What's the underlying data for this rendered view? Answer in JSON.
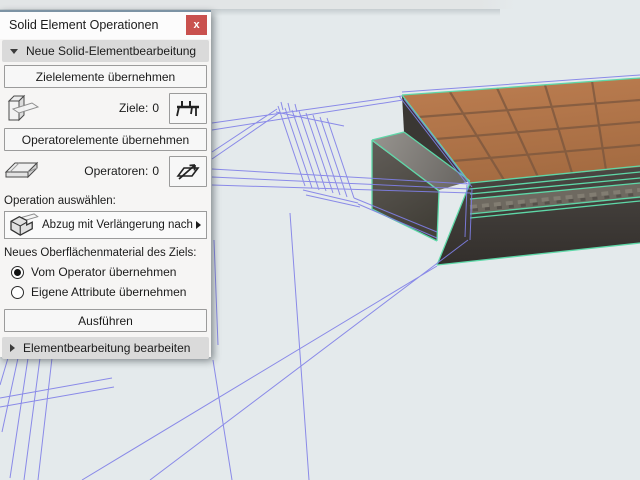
{
  "panel": {
    "title": "Solid Element Operationen",
    "close_label": "x",
    "section_new": {
      "title": "Neue Solid-Elementbearbeitung",
      "pick_targets_button": "Zielelemente übernehmen",
      "targets": {
        "label": "Ziele:",
        "value": "0"
      },
      "pick_operators_button": "Operatorelemente übernehmen",
      "operators": {
        "label": "Operatoren:",
        "value": "0"
      },
      "choose_operation_label": "Operation auswählen:",
      "operation_value": "Abzug mit Verlängerung nach ...",
      "surface_material_label": "Neues Oberflächenmaterial des Ziels:",
      "radio_options": [
        {
          "label": "Vom Operator übernehmen",
          "selected": true
        },
        {
          "label": "Eigene Attribute übernehmen",
          "selected": false
        }
      ],
      "execute_button": "Ausführen"
    },
    "section_edit": {
      "title": "Elementbearbeitung bearbeiten"
    }
  },
  "icons": {
    "close": "x-glyph",
    "section_expanded": "triangle-down",
    "section_collapsed": "triangle-right",
    "flyout_arrow": "triangle-right",
    "target_element": "wall-with-slab-3d",
    "pick_target": "table-platform-glyph",
    "operator_element": "flat-slab-3d",
    "pick_operator": "slab-with-arrow",
    "operation_subtract_extend": "l-block-with-slab"
  },
  "viewport": {
    "description": "3D-Ansicht: Plattform mit Fliesenbelag, Betonstufe und Drahtgitter-Elementen",
    "colors": {
      "background": "#e4eaec",
      "wireframe": "#7f7fe8",
      "selection_highlight": "#5ed8a8",
      "tile_surface": "#b1744a",
      "concrete": "#45413d",
      "accent_line": "#7c93a4",
      "close_button": "#c9514e"
    }
  }
}
